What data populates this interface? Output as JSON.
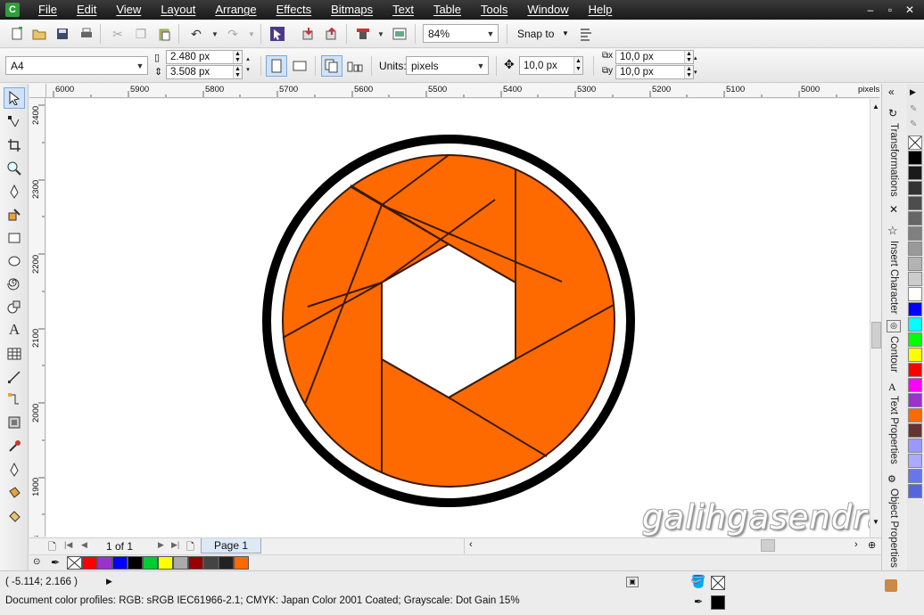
{
  "menubar": {
    "items": [
      "File",
      "Edit",
      "View",
      "Layout",
      "Arrange",
      "Effects",
      "Bitmaps",
      "Text",
      "Table",
      "Tools",
      "Window",
      "Help"
    ],
    "window_controls": [
      "–",
      "▫",
      "✕"
    ]
  },
  "toolbar1": {
    "zoom": "84%",
    "snap_to": "Snap to"
  },
  "toolbar2": {
    "paper_size": "A4",
    "page_width": "2.480 px",
    "page_height": "3.508 px",
    "units_label": "Units:",
    "units_value": "pixels",
    "nudge": "10,0 px",
    "dup_x": "10,0 px",
    "dup_y": "10,0 px"
  },
  "ruler_top": {
    "labels": [
      "6000",
      "5900",
      "5800",
      "5700",
      "5600",
      "5500",
      "5400",
      "5300",
      "5200",
      "5100",
      "5000"
    ],
    "unit": "pixels"
  },
  "ruler_left": {
    "labels": [
      "2400",
      "2300",
      "2200",
      "2100",
      "2000",
      "1900"
    ],
    "unit": "pixels"
  },
  "canvas": {
    "watermark": "galihgasendra",
    "colors": {
      "blade": "#ff6a00",
      "blade_stroke": "#3a1a0a",
      "ring": "#000000"
    }
  },
  "pagebar": {
    "page_count": "1 of 1",
    "page_tab": "Page 1"
  },
  "docker": {
    "tabs": [
      "Transformations",
      "Insert Character",
      "Contour",
      "Text Properties",
      "Object Properties"
    ]
  },
  "palette": {
    "colors": [
      "#000000",
      "#1a1a1a",
      "#333333",
      "#4d4d4d",
      "#666666",
      "#808080",
      "#999999",
      "#b3b3b3",
      "#cccccc",
      "#ffffff",
      "#0000ff",
      "#00ffff",
      "#00ff00",
      "#ffff00",
      "#ff0000",
      "#ff00ff",
      "#9933cc",
      "#ff6a00",
      "#663333",
      "#9999ff",
      "#aaaaff",
      "#6677ee",
      "#5566dd"
    ]
  },
  "docpalette": {
    "colors": [
      "#ff0000",
      "#9933cc",
      "#0000ff",
      "#000000",
      "#00cc33",
      "#ffff00",
      "#aaaaaa",
      "#990000",
      "#444444",
      "#222222",
      "#ff6a00"
    ]
  },
  "status": {
    "coords": "( -5.114; 2.166 )",
    "profiles": "Document color profiles: RGB: sRGB IEC61966-2.1; CMYK: Japan Color 2001 Coated; Grayscale: Dot Gain 15%"
  }
}
